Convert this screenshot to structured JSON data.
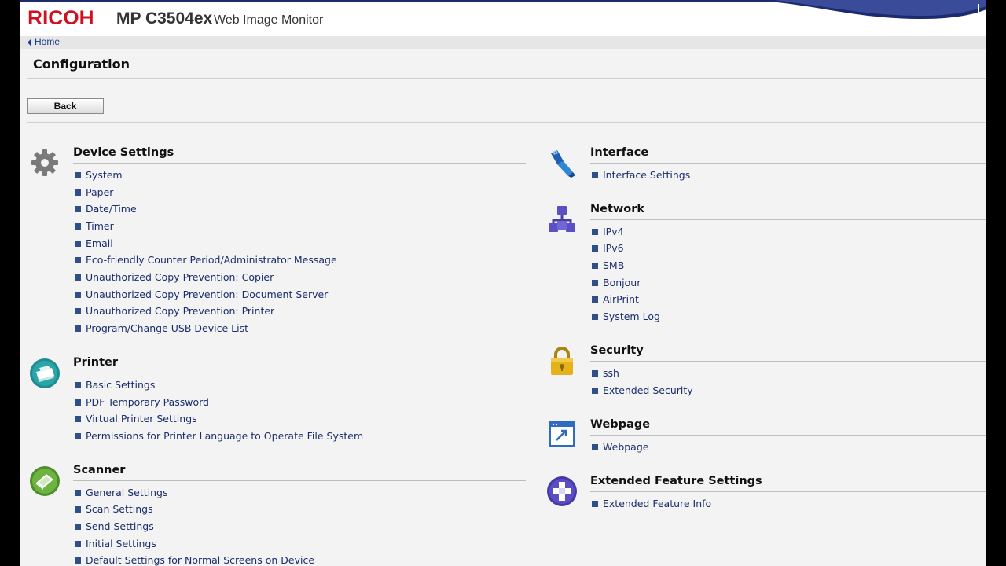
{
  "header": {
    "brand": "RICOH",
    "model": "MP C3504ex",
    "app_name": "Web Image Monitor"
  },
  "nav": {
    "home_label": "Home"
  },
  "page": {
    "title": "Configuration",
    "back_label": "Back"
  },
  "sections": {
    "device": {
      "title": "Device Settings",
      "items": [
        "System",
        "Paper",
        "Date/Time",
        "Timer",
        "Email",
        "Eco-friendly Counter Period/Administrator Message",
        "Unauthorized Copy Prevention: Copier",
        "Unauthorized Copy Prevention: Document Server",
        "Unauthorized Copy Prevention: Printer",
        "Program/Change USB Device List"
      ]
    },
    "printer": {
      "title": "Printer",
      "items": [
        "Basic Settings",
        "PDF Temporary Password",
        "Virtual Printer Settings",
        "Permissions for Printer Language to Operate File System"
      ]
    },
    "scanner": {
      "title": "Scanner",
      "items": [
        "General Settings",
        "Scan Settings",
        "Send Settings",
        "Initial Settings",
        "Default Settings for Normal Screens on Device"
      ]
    },
    "interface": {
      "title": "Interface",
      "items": [
        "Interface Settings"
      ]
    },
    "network": {
      "title": "Network",
      "items": [
        "IPv4",
        "IPv6",
        "SMB",
        "Bonjour",
        "AirPrint",
        "System Log"
      ]
    },
    "security": {
      "title": "Security",
      "items": [
        "ssh",
        "Extended Security"
      ]
    },
    "webpage": {
      "title": "Webpage",
      "items": [
        "Webpage"
      ]
    },
    "extended": {
      "title": "Extended Feature Settings",
      "items": [
        "Extended Feature Info"
      ]
    }
  },
  "icons": {
    "device": "gear-icon",
    "printer": "printer-icon",
    "scanner": "scanner-icon",
    "interface": "network-cable-icon",
    "network": "network-topology-icon",
    "security": "padlock-icon",
    "webpage": "browser-window-icon",
    "extended": "plus-cross-icon"
  },
  "colors": {
    "brand_red": "#cf1020",
    "link_blue": "#1a2e6b",
    "bullet": "#2f4f86",
    "background": "#f3f3f3",
    "header_swoosh": "#1d2a6e"
  }
}
